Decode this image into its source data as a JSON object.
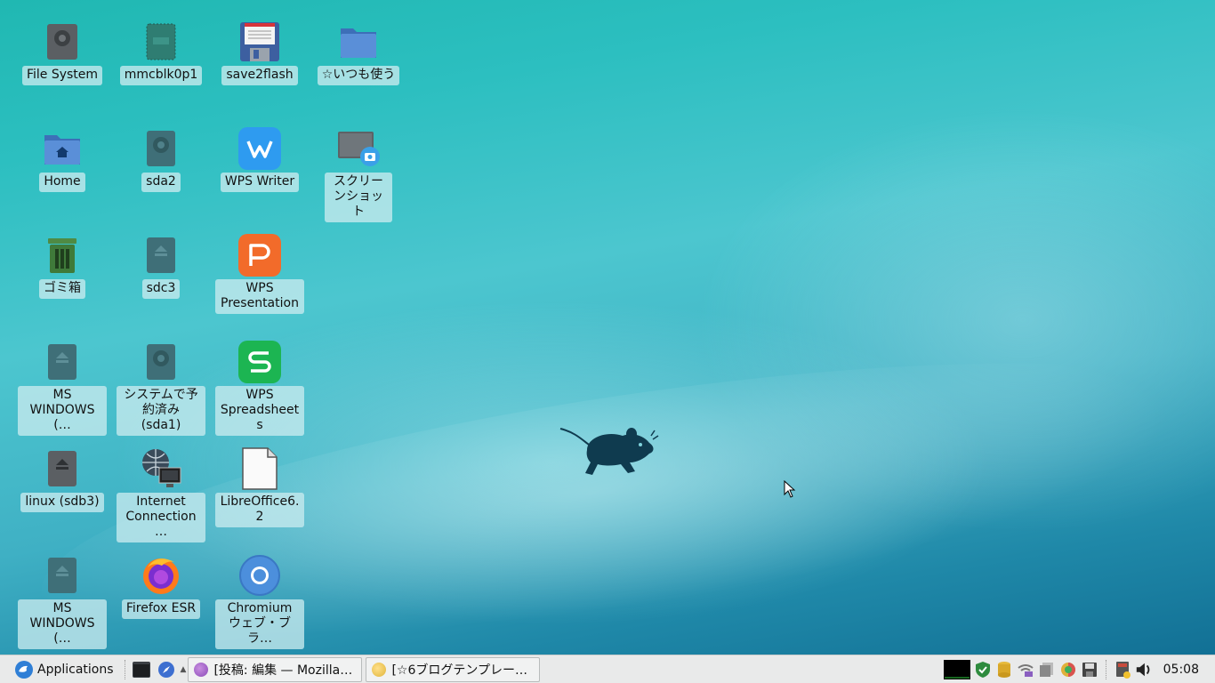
{
  "desktop": {
    "icons": [
      {
        "label": "File System",
        "icon": "drive-harddisk-icon"
      },
      {
        "label": "mmcblk0p1",
        "icon": "sd-card-icon"
      },
      {
        "label": "save2flash",
        "icon": "floppy-save-icon"
      },
      {
        "label": "☆いつも使う",
        "icon": "folder-icon"
      },
      {
        "label": "Home",
        "icon": "home-folder-icon"
      },
      {
        "label": "sda2",
        "icon": "drive-harddisk-icon"
      },
      {
        "label": "WPS Writer",
        "icon": "wps-writer-icon"
      },
      {
        "label": "スクリーンショット",
        "icon": "screenshot-icon"
      },
      {
        "label": "ゴミ箱",
        "icon": "trash-icon"
      },
      {
        "label": "sdc3",
        "icon": "removable-drive-icon"
      },
      {
        "label": "WPS Presentation",
        "icon": "wps-presentation-icon"
      },
      {
        "label": "MS WINDOWS (…",
        "icon": "removable-drive-icon"
      },
      {
        "label": "システムで予約済み (sda1)",
        "icon": "drive-harddisk-icon"
      },
      {
        "label": "WPS Spreadsheets",
        "icon": "wps-spreadsheets-icon"
      },
      {
        "label": "linux (sdb3)",
        "icon": "removable-drive-icon"
      },
      {
        "label": "Internet Connection …",
        "icon": "network-connection-icon"
      },
      {
        "label": "LibreOffice6.2",
        "icon": "document-icon"
      },
      {
        "label": "MS WINDOWS (…",
        "icon": "removable-drive-icon"
      },
      {
        "label": "Firefox ESR",
        "icon": "firefox-icon"
      },
      {
        "label": "Chromium ウェブ・ブラ…",
        "icon": "chromium-icon"
      }
    ]
  },
  "panel": {
    "applications_label": "Applications",
    "tasks": [
      {
        "label": "[投稿: 編集 — Mozilla Fir…",
        "icon": "firefox-icon"
      },
      {
        "label": "[☆6ブログテンプレート …",
        "icon": "file-manager-icon"
      }
    ],
    "clock": "05:08"
  },
  "colors": {
    "wps_writer": "#2e9bf0",
    "wps_presentation": "#f26b2a",
    "wps_spreadsheets": "#1cb552",
    "trash": "#3f7a3a",
    "panel_bg": "#e9eaea"
  }
}
